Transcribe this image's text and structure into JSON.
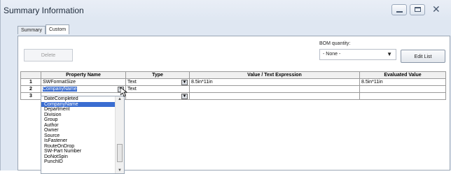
{
  "window": {
    "title": "Summary Information"
  },
  "tabs": [
    "Summary",
    "Custom"
  ],
  "toolbar": {
    "delete_label": "Delete",
    "bom_label": "BOM quantity:",
    "bom_value": "- None -",
    "edit_list_label": "Edit List"
  },
  "table": {
    "headers": [
      "Property Name",
      "Type",
      "Value / Text Expression",
      "Evaluated Value"
    ],
    "rows": [
      {
        "num": "1",
        "name": "SWFormatSize",
        "type": "Text",
        "value": "8.5in*11in",
        "evaluated": "8.5in*11in"
      },
      {
        "num": "2",
        "name": "CompanyName",
        "type": "Text",
        "value": "",
        "evaluated": ""
      },
      {
        "num": "3",
        "name": "",
        "type": "",
        "value": "",
        "evaluated": ""
      }
    ]
  },
  "dropdown": {
    "items": [
      "DateCompleted",
      "CompanyName",
      "Department",
      "Division",
      "Group",
      "Author",
      "Owner",
      "Source",
      "IsFastener",
      "RouteOnDrop",
      "SW-Part Number",
      "DoNotSpin",
      "PunchID"
    ],
    "selected": "CompanyName"
  },
  "colors": {
    "selection": "#3a6dd1",
    "window_bg": "#dfe7f2"
  }
}
